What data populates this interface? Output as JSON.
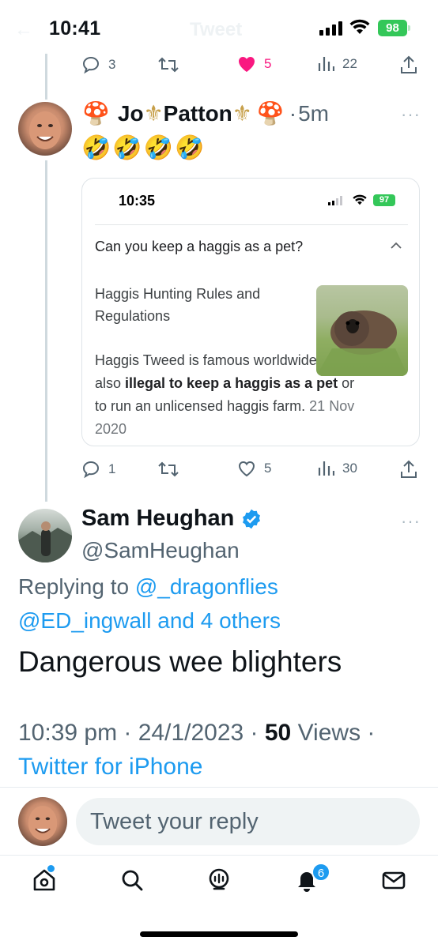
{
  "status_bar": {
    "time": "10:41",
    "battery": "98",
    "faded_title": "Tweet"
  },
  "tweet_top_actions": {
    "replies": "3",
    "likes": "5",
    "views": "22"
  },
  "tweet1": {
    "name_prefix_emoji": "🍄",
    "name_first": "Jo",
    "name_last": "Patton",
    "name_suffix_emoji": "🍄",
    "fleur": "⚜",
    "time": "5m",
    "text": "🤣🤣🤣🤣",
    "card": {
      "time": "10:35",
      "battery": "97",
      "question": "Can you keep a haggis as a pet?",
      "heading": "Haggis Hunting Rules and Regulations",
      "body_1": "Haggis Tweed is famous worldwide. It is also ",
      "body_bold": "illegal to keep a haggis as a pet",
      "body_2": " or to run an unlicensed haggis farm. ",
      "date": "21 Nov 2020"
    },
    "actions": {
      "replies": "1",
      "likes": "5",
      "views": "30"
    }
  },
  "tweet2": {
    "name": "Sam Heughan",
    "handle": "@SamHeughan",
    "replying_prefix": "Replying to ",
    "mention_1": "@_dragonflies",
    "mention_2": "@ED_ingwall and 4 others",
    "text": "Dangerous wee blighters",
    "meta_time": "10:39 pm · 24/1/2023 · ",
    "views_count": "50",
    "views_label": " Views ·",
    "source": "Twitter for iPhone"
  },
  "reply": {
    "placeholder": "Tweet your reply"
  },
  "nav": {
    "notifications_badge": "6"
  },
  "colors": {
    "accent": "#1d9bf0",
    "like": "#f91880",
    "battery": "#34c759"
  }
}
